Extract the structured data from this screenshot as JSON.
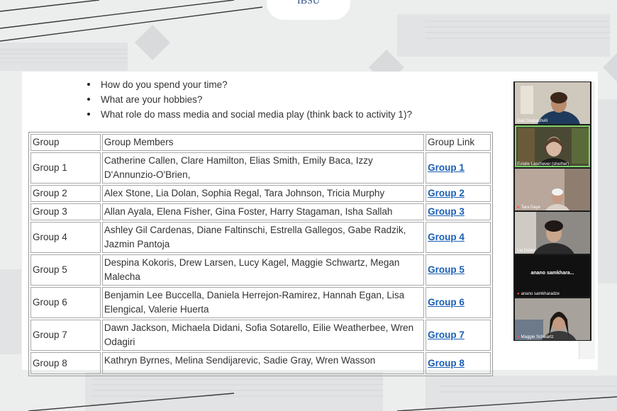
{
  "logo": {
    "text": "IBSU"
  },
  "questions": [
    "How do you spend your time?",
    "What are your hobbies?",
    "What role do mass media and social media play (think back to activity 1)?"
  ],
  "table": {
    "headers": [
      "Group",
      "Group Members",
      "Group Link"
    ],
    "rows": [
      {
        "group": "Group 1",
        "members": "Catherine Callen, Clare Hamilton, Elias Smith, Emily Baca, Izzy D'Annunzio-O'Brien,",
        "link": "Group 1"
      },
      {
        "group": "Group 2",
        "members": "Alex Stone, Lia Dolan, Sophia Regal, Tara Johnson, Tricia Murphy",
        "link": "Group 2"
      },
      {
        "group": "Group 3",
        "members": "Allan Ayala, Elena Fisher, Gina Foster, Harry Stagaman, Isha Sallah",
        "link": "Group 3"
      },
      {
        "group": "Group 4",
        "members": "Ashley Gil Cardenas, Diane Faltinschi, Estrella Gallegos, Gabe Radzik, Jazmin Pantoja",
        "link": "Group 4"
      },
      {
        "group": "Group 5",
        "members": "Despina Kokoris, Drew Larsen, Lucy Kagel, Maggie Schwartz, Megan Malecha",
        "link": "Group 5"
      },
      {
        "group": "Group 6",
        "members": "Benjamin Lee Buccella, Daniela Herrejon-Ramirez, Hannah Egan, Lisa Elengical, Valerie Huerta",
        "link": "Group 6"
      },
      {
        "group": "Group 7",
        "members": "Dawn Jackson, Michaela Didani, Sofia Sotarello, Eilie Weatherbee, Wren Odagiri",
        "link": "Group 7"
      },
      {
        "group": "Group 8",
        "members": "Kathryn Byrnes, Melina Sendijarevic, Sadie Gray, Wren Wasson",
        "link": "Group 8"
      }
    ]
  },
  "participants": [
    {
      "name": "Dali Osepashvili",
      "muted": false,
      "active": false,
      "video": true
    },
    {
      "name": "Eulalie Laschever (she/her)",
      "muted": false,
      "active": true,
      "video": true
    },
    {
      "name": "Tara Daye",
      "muted": true,
      "active": false,
      "video": true
    },
    {
      "name": "Lia Dolan",
      "muted": false,
      "active": false,
      "video": true
    },
    {
      "name": "anano samkharadze",
      "display": "anano samkhara...",
      "muted": true,
      "active": false,
      "video": false
    },
    {
      "name": "Maggie Schwartz",
      "muted": true,
      "active": false,
      "video": true
    }
  ],
  "colors": {
    "link": "#1a5fb4",
    "active_speaker": "#7dd36b",
    "muted": "#ff4b4b"
  }
}
